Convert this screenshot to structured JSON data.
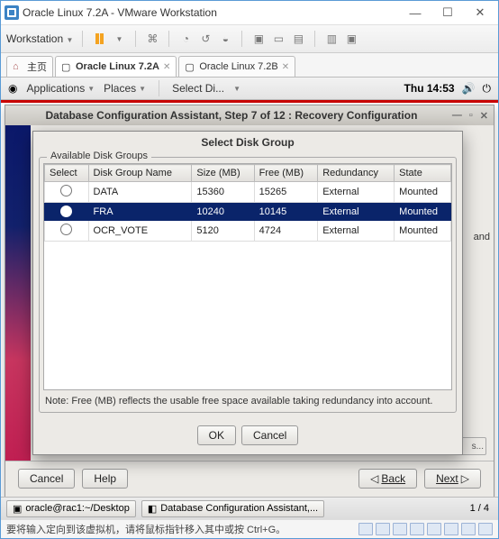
{
  "vm": {
    "title": "Oracle Linux 7.2A - VMware Workstation",
    "workstation_label": "Workstation",
    "status_text": "要将输入定向到该虚拟机，请将鼠标指针移入其中或按 Ctrl+G。",
    "tabs": {
      "home": "主页",
      "t1": "Oracle Linux 7.2A",
      "t2": "Oracle Linux 7.2B"
    }
  },
  "gnome": {
    "applications": "Applications",
    "places": "Places",
    "select_di": "Select Di...",
    "clock": "Thu 14:53"
  },
  "dbca": {
    "title": "Database Configuration Assistant, Step 7 of 12 : Recovery Configuration",
    "cancel": "Cancel",
    "help": "Help",
    "back": "Back",
    "next": "Next",
    "and": "and",
    "sbtn": "s..."
  },
  "dialog": {
    "title": "Select Disk Group",
    "groupbox": "Available Disk Groups",
    "cols": {
      "c0": "Select",
      "c1": "Disk Group Name",
      "c2": "Size (MB)",
      "c3": "Free (MB)",
      "c4": "Redundancy",
      "c5": "State"
    },
    "rows": [
      {
        "sel": false,
        "name": "DATA",
        "size": "15360",
        "free": "15265",
        "red": "External",
        "state": "Mounted"
      },
      {
        "sel": true,
        "name": "FRA",
        "size": "10240",
        "free": "10145",
        "red": "External",
        "state": "Mounted"
      },
      {
        "sel": false,
        "name": "OCR_VOTE",
        "size": "5120",
        "free": "4724",
        "red": "External",
        "state": "Mounted"
      }
    ],
    "note": "Note:  Free (MB) reflects the usable free space available taking redundancy into account.",
    "ok": "OK",
    "cancel": "Cancel"
  },
  "taskbar": {
    "term": "oracle@rac1:~/Desktop",
    "dbca": "Database Configuration Assistant,...",
    "page": "1 / 4"
  }
}
